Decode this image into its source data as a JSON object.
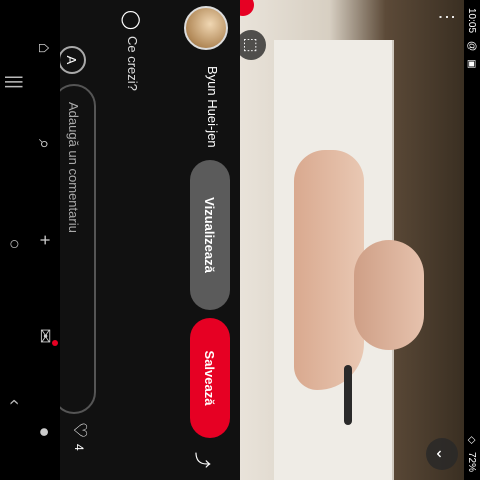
{
  "status_bar": {
    "time": "10:05",
    "battery": "72%",
    "indicators": [
      "notification-icon",
      "media-icon"
    ]
  },
  "video": {
    "more_icon": "⋮",
    "scan_icon": "⬚",
    "expand_icon": "⌄"
  },
  "creator": {
    "name": "Byun Huei-jen",
    "visit_label": "Vizualizează",
    "save_label": "Salvează",
    "share_icon": "⤴"
  },
  "comments": {
    "label": "Ce crezi?",
    "avatar_letter": "A",
    "placeholder": "Adaugă un comentariu",
    "like_icon": "♡",
    "like_count": "4"
  },
  "nav": {
    "items": [
      {
        "name": "home",
        "icon": "⌂"
      },
      {
        "name": "search",
        "icon": "⌕"
      },
      {
        "name": "create",
        "icon": "+"
      },
      {
        "name": "messages",
        "icon": "✉"
      },
      {
        "name": "profile",
        "icon": "●"
      }
    ]
  },
  "system_nav": {
    "recents": "|||",
    "home": "○",
    "back": "‹"
  },
  "colors": {
    "accent": "#e60023",
    "panel_bg": "#111111",
    "secondary_button": "#5b5b5b"
  }
}
